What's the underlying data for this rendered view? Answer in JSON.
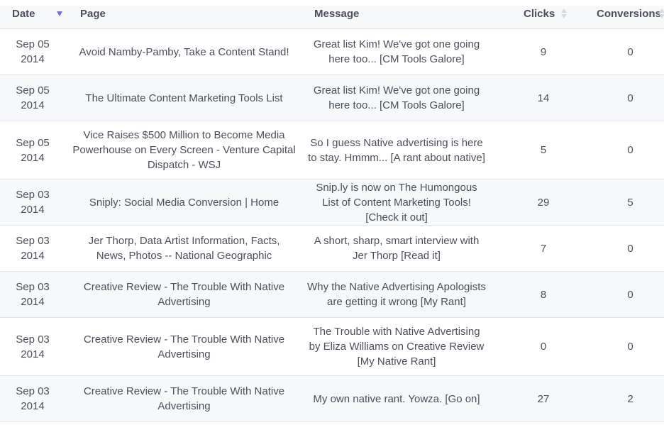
{
  "headers": {
    "date": "Date",
    "page": "Page",
    "message": "Message",
    "clicks": "Clicks",
    "conversions": "Conversions"
  },
  "sort": {
    "active_column": "date",
    "direction": "descending",
    "indicator_color": "#6d6fe0"
  },
  "rows": [
    {
      "date_md": "Sep 05",
      "date_y": "2014",
      "page": "Avoid Namby-Pamby, Take a Content Stand!",
      "message": "Great list Kim! We've got one going here too... [CM Tools Galore]",
      "clicks": "9",
      "conversions": "0"
    },
    {
      "date_md": "Sep 05",
      "date_y": "2014",
      "page": "The Ultimate Content Marketing Tools List",
      "message": "Great list Kim! We've got one going here too... [CM Tools Galore]",
      "clicks": "14",
      "conversions": "0"
    },
    {
      "date_md": "Sep 05",
      "date_y": "2014",
      "page": "Vice Raises $500 Million to Become Media Powerhouse on Every Screen - Venture Capital Dispatch - WSJ",
      "message": "So I guess Native advertising is here to stay. Hmmm... [A rant about native]",
      "clicks": "5",
      "conversions": "0"
    },
    {
      "date_md": "Sep 03",
      "date_y": "2014",
      "page": "Sniply: Social Media Conversion | Home",
      "message": "Snip.ly is now on The Humongous List of Content Marketing Tools! [Check it out]",
      "clicks": "29",
      "conversions": "5"
    },
    {
      "date_md": "Sep 03",
      "date_y": "2014",
      "page": "Jer Thorp, Data Artist Information, Facts, News, Photos -- National Geographic",
      "message": "A short, sharp, smart interview with Jer Thorp [Read it]",
      "clicks": "7",
      "conversions": "0"
    },
    {
      "date_md": "Sep 03",
      "date_y": "2014",
      "page": "Creative Review - The Trouble With Native Advertising",
      "message": "Why the Native Advertising Apologists are getting it wrong [My Rant]",
      "clicks": "8",
      "conversions": "0"
    },
    {
      "date_md": "Sep 03",
      "date_y": "2014",
      "page": "Creative Review - The Trouble With Native Advertising",
      "message": "The Trouble with Native Advertising by Eliza Williams on Creative Review [My Native Rant]",
      "clicks": "0",
      "conversions": "0"
    },
    {
      "date_md": "Sep 03",
      "date_y": "2014",
      "page": "Creative Review - The Trouble With Native Advertising",
      "message": "My own native rant. Yowza. [Go on]",
      "clicks": "27",
      "conversions": "2"
    }
  ]
}
